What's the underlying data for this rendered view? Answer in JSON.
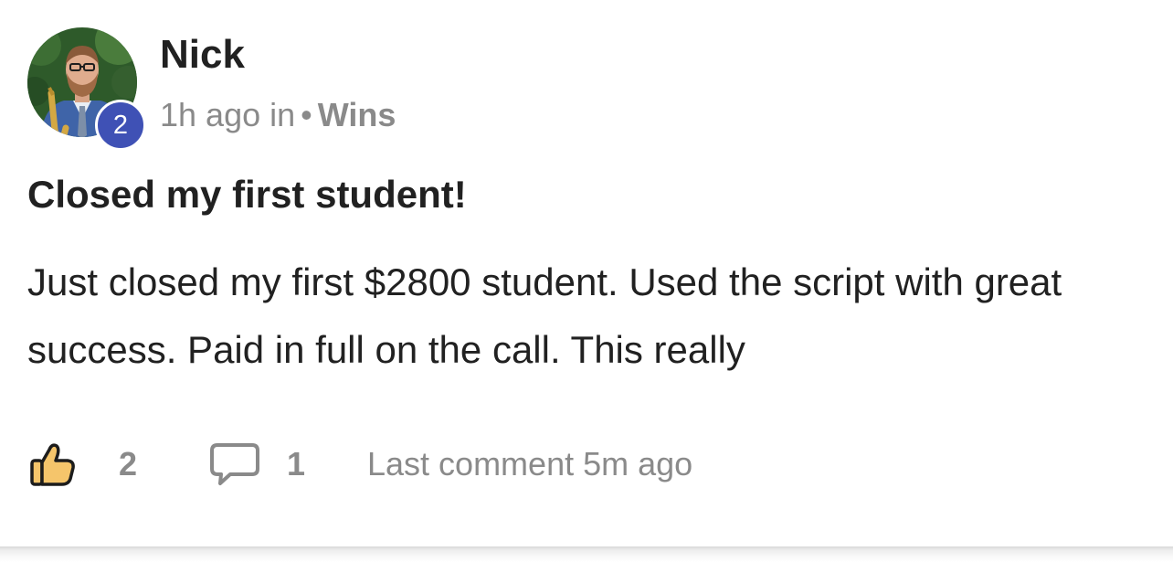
{
  "post": {
    "author": "Nick",
    "level": "2",
    "time": "1h ago in",
    "separator": "•",
    "category": "Wins",
    "title": "Closed my first student!",
    "body": "Just closed my first $2800 student. Used the script with great success. Paid in full on the call. This really",
    "likes": "2",
    "comments": "1",
    "last_comment": "Last comment 5m ago",
    "icons": {
      "like": "thumbs-up-icon",
      "comment": "comment-bubble-icon"
    },
    "colors": {
      "badge": "#3f51b5",
      "like_fill": "#f5c56b",
      "muted_text": "#8a8a8a",
      "primary_text": "#212121"
    }
  }
}
